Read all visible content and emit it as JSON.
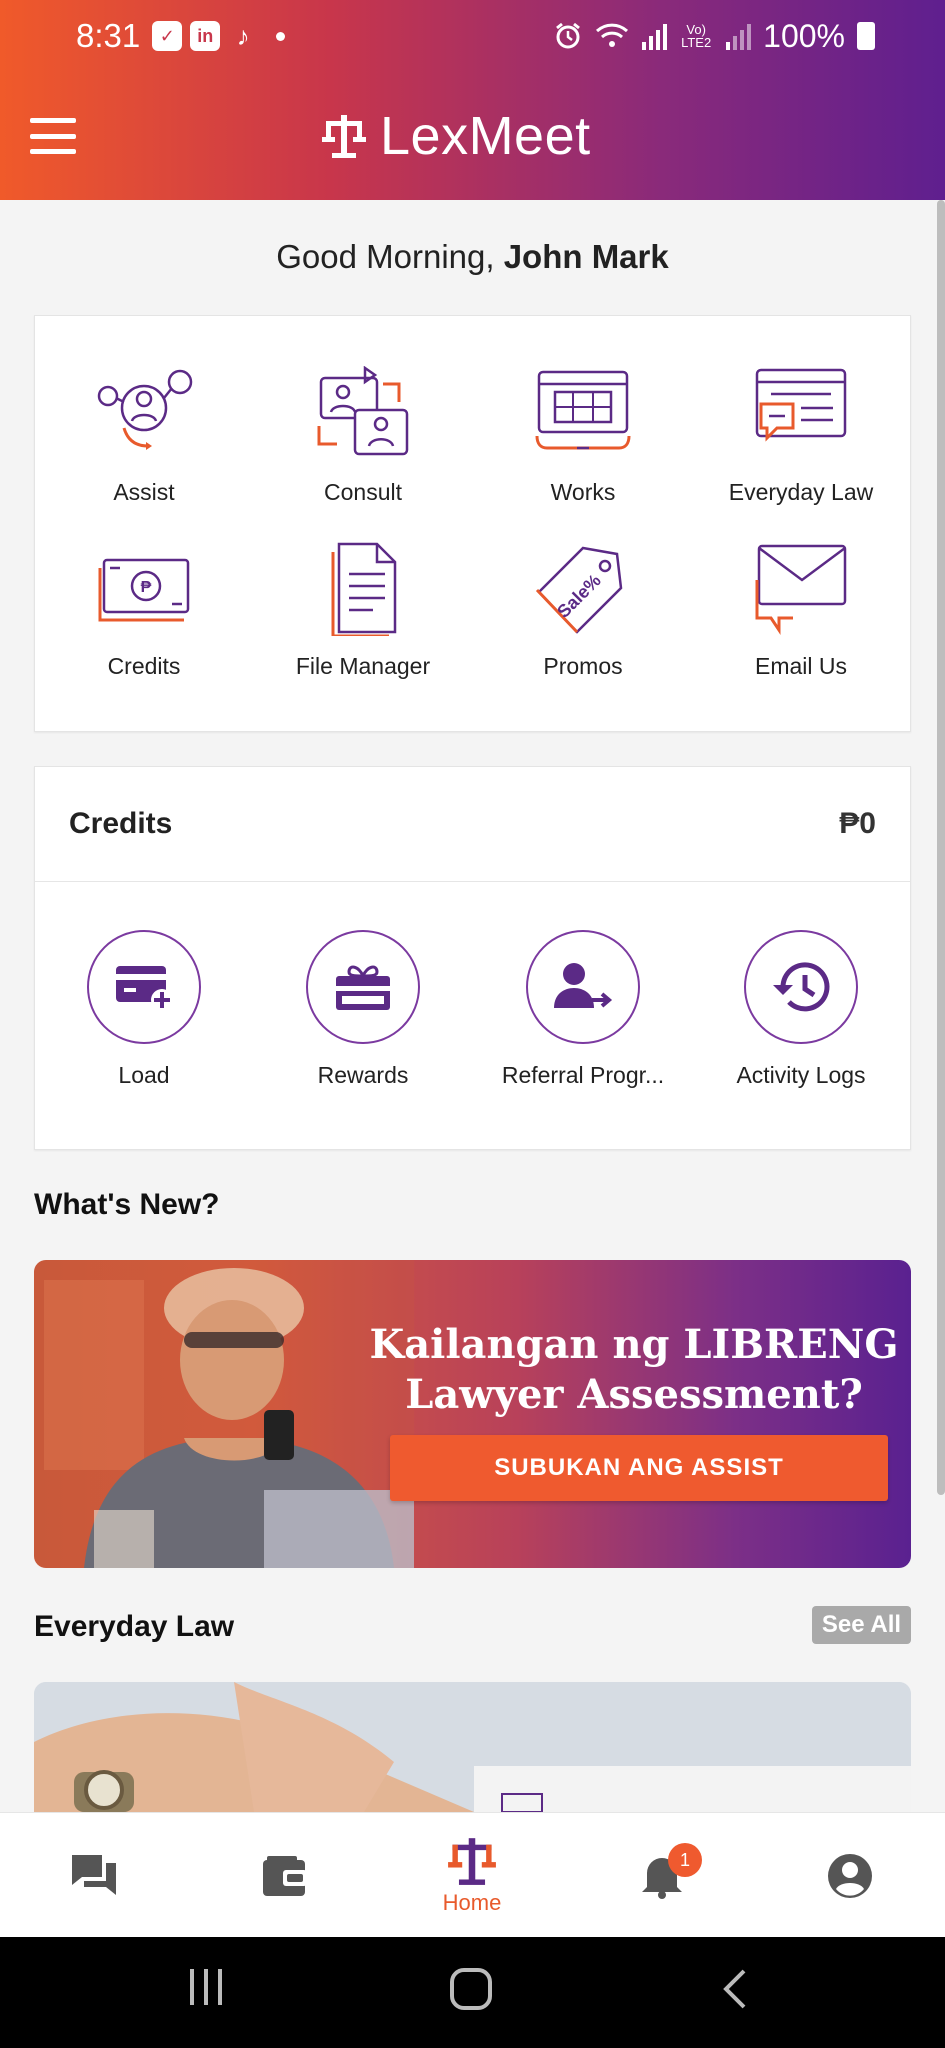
{
  "status_bar": {
    "time": "8:31",
    "apps": [
      "messenger-icon",
      "linkedin-icon",
      "tiktok-icon"
    ],
    "network_label": "Vo) LTE2",
    "battery": "100%"
  },
  "header": {
    "app_name": "LexMeet"
  },
  "greeting": {
    "prefix": "Good Morning,",
    "name": "John Mark"
  },
  "services": [
    {
      "label": "Assist",
      "icon": "assist-icon"
    },
    {
      "label": "Consult",
      "icon": "consult-icon"
    },
    {
      "label": "Works",
      "icon": "works-icon"
    },
    {
      "label": "Everyday Law",
      "icon": "everyday-law-icon"
    },
    {
      "label": "Credits",
      "icon": "credits-icon"
    },
    {
      "label": "File Manager",
      "icon": "file-manager-icon"
    },
    {
      "label": "Promos",
      "icon": "promos-icon"
    },
    {
      "label": "Email Us",
      "icon": "email-icon"
    }
  ],
  "credits": {
    "title": "Credits",
    "amount": "₱0",
    "actions": [
      {
        "label": "Load",
        "icon": "load-card-icon"
      },
      {
        "label": "Rewards",
        "icon": "gift-icon"
      },
      {
        "label": "Referral Progr...",
        "icon": "referral-icon"
      },
      {
        "label": "Activity Logs",
        "icon": "history-icon"
      }
    ]
  },
  "whats_new": {
    "title": "What's New?",
    "banner": {
      "headline_line1": "Kailangan ng LIBRENG",
      "headline_line2": "Lawyer Assessment?",
      "cta": "SUBUKAN ANG ASSIST"
    }
  },
  "everyday_law": {
    "title": "Everyday Law",
    "see_all": "See All"
  },
  "bottom_nav": {
    "items": [
      {
        "icon": "chat-icon"
      },
      {
        "icon": "wallet-icon"
      },
      {
        "icon": "home-icon",
        "label": "Home",
        "active": true
      },
      {
        "icon": "bell-icon",
        "badge": "1"
      },
      {
        "icon": "profile-icon"
      }
    ]
  },
  "colors": {
    "orange": "#ef5a2f",
    "purple": "#5f1f8f",
    "icon_purple": "#5b2a86",
    "icon_orange": "#e85a2c"
  }
}
